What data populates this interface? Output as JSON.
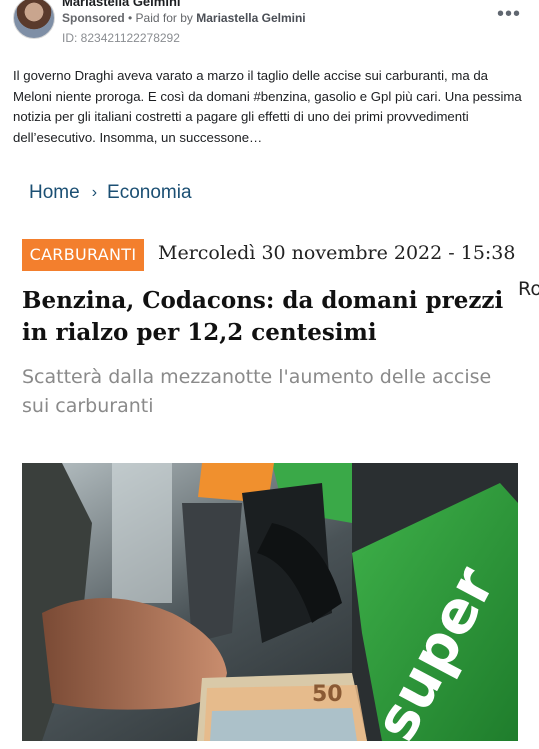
{
  "post": {
    "author": "Mariastella Gelmini",
    "sponsored_label": "Sponsored",
    "separator": " • ",
    "paid_for_prefix": "Paid for by ",
    "paid_for_name": "Mariastella Gelmini",
    "ad_id": "ID: 823421122278292",
    "more_icon": "more-options-icon",
    "text": "Il governo Draghi aveva varato a marzo il taglio delle accise sui carburanti, ma da Meloni niente proroga. E così da domani #benzina, gasolio e Gpl più cari. Una pessima notizia per gli italiani costretti a pagare gli effetti di uno dei primi provvedimenti dell’esecutivo. Insomma, un successone…"
  },
  "article": {
    "breadcrumb": {
      "home": "Home",
      "separator": "›",
      "section": "Economia"
    },
    "category": "CARBURANTI",
    "date": "Mercoledì 30 novembre 2022 - 15:38",
    "headline": "Benzina, Codacons: da domani prezzi in rialzo per 12,2 centesimi",
    "cut_off_text": "Ro",
    "subheadline": "Scatterà dalla mezzanotte l'aumento delle accise sui carburanti",
    "photo": {
      "nozzle_label": "super",
      "banknote_value": "50"
    }
  },
  "colors": {
    "category_bg": "#f37f2d",
    "breadcrumb": "#1b4f73",
    "pump_green": "#2e9a3c"
  }
}
